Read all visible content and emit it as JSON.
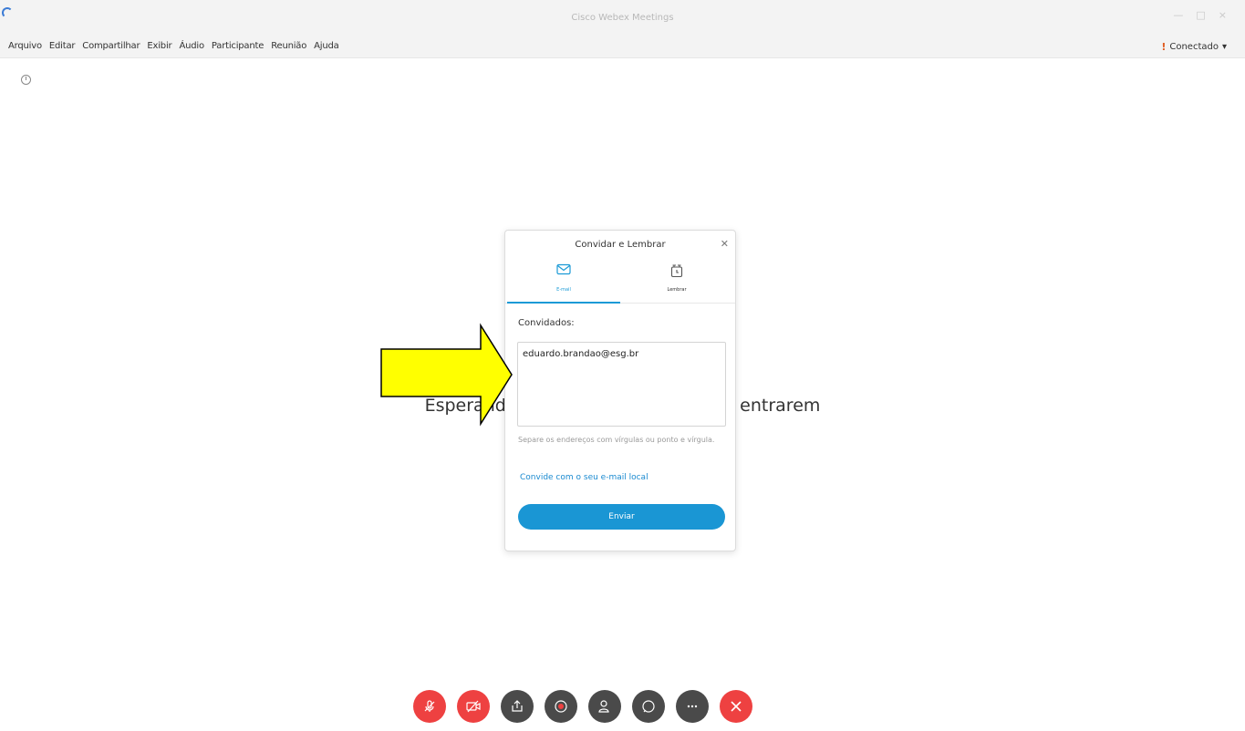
{
  "window": {
    "title": "Cisco Webex Meetings"
  },
  "window_controls": {
    "minimize": "—",
    "maximize": "□",
    "close": "×"
  },
  "menu": [
    "Arquivo",
    "Editar",
    "Compartilhar",
    "Exibir",
    "Áudio",
    "Participante",
    "Reunião",
    "Ajuda"
  ],
  "status": {
    "label": "Conectado"
  },
  "main": {
    "waiting_text": "Esperando que outros participantes entrarem"
  },
  "dialog": {
    "title": "Convidar e Lembrar",
    "tabs": [
      {
        "label": "E-mail",
        "icon": "envelope-icon",
        "active": true
      },
      {
        "label": "Lembrar",
        "icon": "alarm-clock-icon",
        "active": false
      }
    ],
    "guests_label": "Convidados:",
    "guests_value": "eduardo.brandao@esg.br",
    "hint": "Separe os endereços com vírgulas ou ponto e vírgula.",
    "local_email_link": "Convide com o seu e-mail local",
    "send_label": "Enviar"
  },
  "colors": {
    "accent": "#1a96d4",
    "danger": "#ee4141",
    "control_dark": "#4a4a4a",
    "annotation_arrow": "#ffff00"
  },
  "controls": [
    {
      "name": "mute-button",
      "icon": "microphone-muted-icon",
      "color": "red"
    },
    {
      "name": "video-button",
      "icon": "video-off-icon",
      "color": "red"
    },
    {
      "name": "share-button",
      "icon": "share-icon",
      "color": "dark"
    },
    {
      "name": "record-button",
      "icon": "record-icon",
      "color": "dark"
    },
    {
      "name": "participants-button",
      "icon": "participants-icon",
      "color": "dark"
    },
    {
      "name": "chat-button",
      "icon": "chat-icon",
      "color": "dark"
    },
    {
      "name": "more-button",
      "icon": "more-icon",
      "color": "dark"
    },
    {
      "name": "leave-button",
      "icon": "close-icon",
      "color": "red"
    }
  ]
}
